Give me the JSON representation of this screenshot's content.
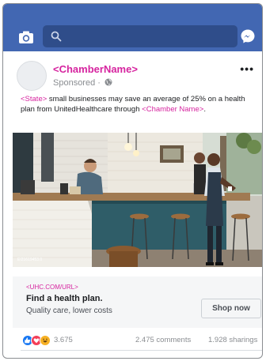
{
  "colors": {
    "brand_blue": "#4267b2",
    "accent_pink": "#d6249f",
    "cta_background": "#f5f6f7"
  },
  "topbar": {
    "camera_icon": "camera-icon",
    "search_icon": "search-icon",
    "messenger_icon": "messenger-icon"
  },
  "post": {
    "page_name": "<ChamberName>",
    "sponsored_label": "Sponsored",
    "sponsored_separator": "·",
    "privacy_icon": "globe-icon",
    "more_label": "•••",
    "text": {
      "state": "<State>",
      "part1": " small businesses may save an average of 25% on a health plan from UnitedHealthcare through ",
      "chamber": "<Chamber Name>",
      "part2": "."
    },
    "image": {
      "description": "photo-cafe-coffee-shop",
      "code": "EI21619453.0"
    },
    "cta": {
      "url": "<UHC.COM/URL>",
      "title": "Find a health plan.",
      "subtitle": "Quality care, lower costs",
      "button_label": "Shop now"
    },
    "stats": {
      "reaction_icons": [
        "like-icon",
        "love-icon",
        "haha-icon"
      ],
      "reaction_count": "3.675",
      "comments": "2.475 comments",
      "sharings": "1.928 sharings"
    }
  }
}
